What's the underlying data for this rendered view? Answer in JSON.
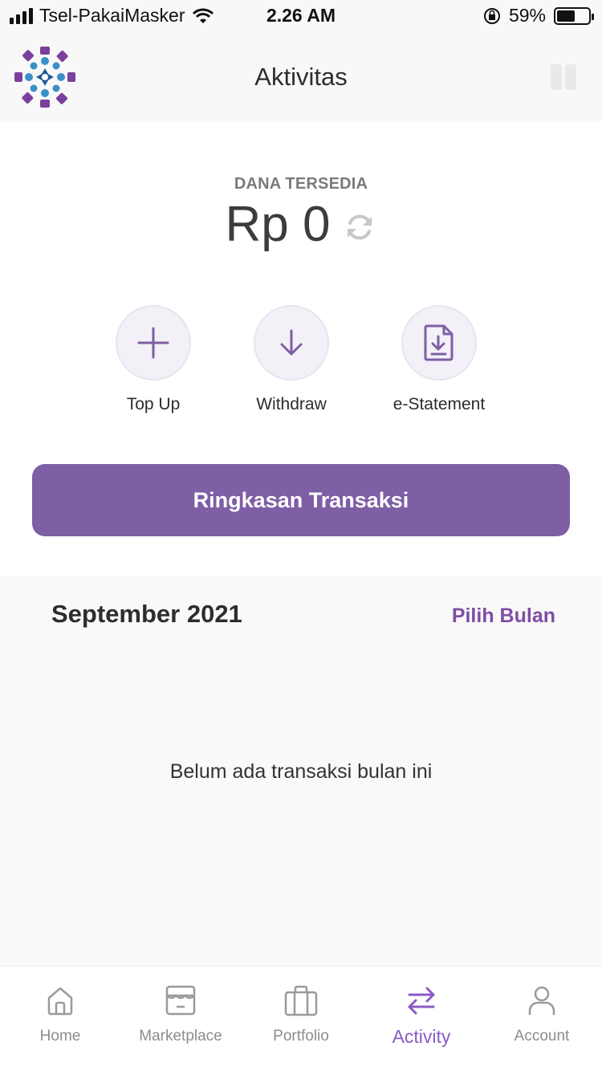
{
  "status_bar": {
    "carrier": "Tsel-PakaiMasker",
    "time": "2.26 AM",
    "battery": "59%",
    "battery_level": 0.59
  },
  "header": {
    "title": "Aktivitas"
  },
  "balance": {
    "label": "DANA TERSEDIA",
    "value": "Rp 0"
  },
  "actions": [
    {
      "label": "Top Up",
      "icon": "plus-icon"
    },
    {
      "label": "Withdraw",
      "icon": "arrow-down-icon"
    },
    {
      "label": "e-Statement",
      "icon": "document-download-icon"
    }
  ],
  "summary_button": {
    "label": "Ringkasan Transaksi"
  },
  "transactions": {
    "month": "September 2021",
    "pick_month": "Pilih Bulan",
    "empty_message": "Belum ada transaksi bulan ini"
  },
  "bottom_nav": {
    "items": [
      {
        "label": "Home",
        "icon": "home-icon",
        "active": false
      },
      {
        "label": "Marketplace",
        "icon": "marketplace-icon",
        "active": false
      },
      {
        "label": "Portfolio",
        "icon": "briefcase-icon",
        "active": false
      },
      {
        "label": "Activity",
        "icon": "swap-arrows-icon",
        "active": true
      },
      {
        "label": "Account",
        "icon": "user-icon",
        "active": false
      }
    ]
  },
  "colors": {
    "accent": "#7e5ea5",
    "accent_text": "#7e4ea5",
    "nav_active": "#8a5bc4",
    "nav_inactive": "#8d8d8d"
  }
}
